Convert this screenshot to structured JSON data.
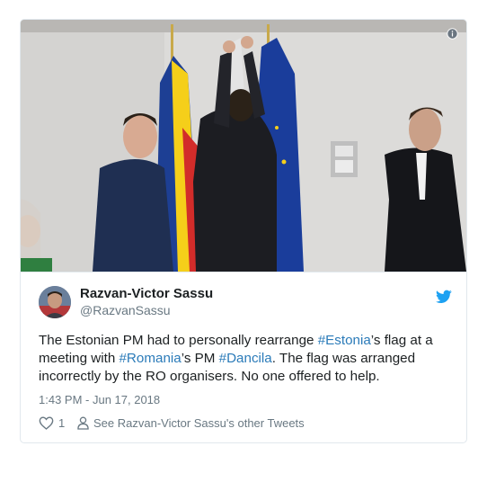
{
  "tweet": {
    "display_name": "Razvan-Victor Sassu",
    "handle": "@RazvanSassu",
    "text_parts": {
      "p1": "The Estonian PM had to personally rearrange ",
      "tag1": "#Estonia",
      "p2": "’s flag at a meeting with ",
      "tag2": "#Romania",
      "p3": "’s PM ",
      "tag3": "#Dancila",
      "p4": ". The flag was arranged incorrectly by the RO organisers. No one offered to help."
    },
    "timestamp": "1:43 PM - Jun 17, 2018",
    "like_count": "1",
    "other_tweets_label": "See Razvan-Victor Sassu's other Tweets"
  },
  "icons": {
    "info": "info-icon",
    "bird": "twitter-bird-icon",
    "heart": "heart-icon",
    "person": "person-icon"
  },
  "colors": {
    "link": "#2b7bb9",
    "muted": "#697882",
    "twitter_blue": "#1da1f2",
    "border": "#e1e8ed"
  }
}
